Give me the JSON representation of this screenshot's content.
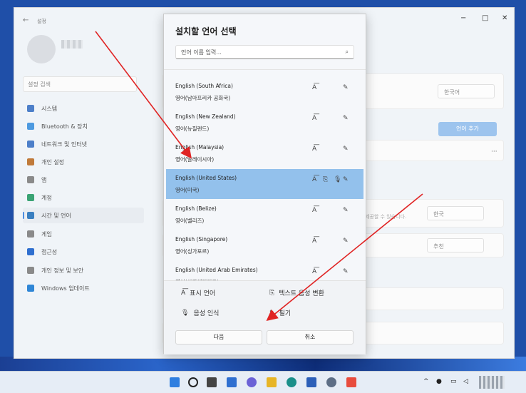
{
  "window": {
    "title": "설정",
    "back_label": "←",
    "minimize": "−",
    "maximize": "□",
    "close": "✕"
  },
  "sidebar": {
    "search_placeholder": "설정 검색",
    "items": [
      {
        "label": "시스템",
        "color": "#4d7fc9"
      },
      {
        "label": "Bluetooth & 장치",
        "color": "#4d9ae0"
      },
      {
        "label": "네트워크 및 인터넷",
        "color": "#4d7fc9"
      },
      {
        "label": "개인 설정",
        "color": "#c07a3a"
      },
      {
        "label": "앱",
        "color": "#8a8a8a"
      },
      {
        "label": "계정",
        "color": "#3aa374"
      },
      {
        "label": "시간 및 언어",
        "color": "#3a7fc0"
      },
      {
        "label": "게임",
        "color": "#8a8a8a"
      },
      {
        "label": "접근성",
        "color": "#2f6fcf"
      },
      {
        "label": "개인 정보 및 보안",
        "color": "#8a8a8a"
      },
      {
        "label": "Windows 업데이트",
        "color": "#2f86d6"
      }
    ]
  },
  "content": {
    "region_value": "한국어",
    "add_language_button": "언어 추가",
    "more": "···",
    "faint_text": "제공할 수 있습니다.",
    "region_country": "한국",
    "format_value": "추천"
  },
  "dialog": {
    "title": "설치할 언어 선택",
    "search_placeholder": "언어 이름 입력...",
    "languages": [
      {
        "en": "English (South Africa)",
        "ko": "영어(남아프리카 공화국)",
        "selected": false,
        "icons": [
          "display-language-icon",
          "handwriting-icon"
        ]
      },
      {
        "en": "English (New Zealand)",
        "ko": "영어(뉴질랜드)",
        "selected": false,
        "icons": [
          "display-language-icon",
          "handwriting-icon"
        ]
      },
      {
        "en": "English (Malaysia)",
        "ko": "영어(말레이시아)",
        "selected": false,
        "icons": [
          "display-language-icon",
          "handwriting-icon"
        ]
      },
      {
        "en": "English (United States)",
        "ko": "영어(미국)",
        "selected": true,
        "icons": [
          "display-language-icon",
          "text-to-speech-icon",
          "speech-recognition-icon",
          "handwriting-icon"
        ]
      },
      {
        "en": "English (Belize)",
        "ko": "영어(벨리즈)",
        "selected": false,
        "icons": [
          "display-language-icon",
          "handwriting-icon"
        ]
      },
      {
        "en": "English (Singapore)",
        "ko": "영어(싱가포르)",
        "selected": false,
        "icons": [
          "display-language-icon",
          "handwriting-icon"
        ]
      },
      {
        "en": "English (United Arab Emirates)",
        "ko": "영어(아랍에미리트)",
        "selected": false,
        "icons": [
          "display-language-icon",
          "handwriting-icon"
        ]
      }
    ],
    "legend": {
      "display_language": "표시 언어",
      "text_to_speech": "텍스트 음성 변환",
      "speech_recognition": "음성 인식",
      "handwriting": "필기"
    },
    "next_button": "다음",
    "cancel_button": "취소"
  },
  "taskbar": {
    "tray_chevron": "^"
  },
  "annotation_color": "#e02424"
}
